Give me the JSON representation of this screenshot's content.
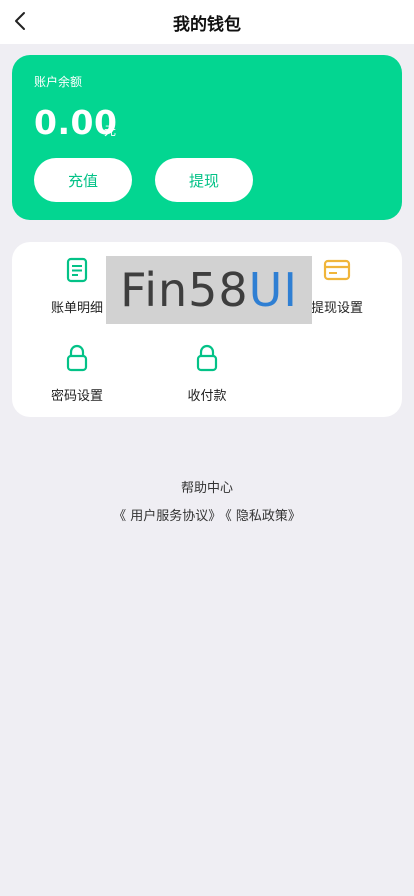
{
  "header": {
    "title": "我的钱包"
  },
  "balance": {
    "label": "账户余额",
    "amount": "0.00",
    "unit": "元",
    "recharge_label": "充值",
    "withdraw_label": "提现"
  },
  "menu": {
    "items": [
      {
        "label": "账单明细",
        "icon": "bill-icon",
        "color": "#03c287"
      },
      {
        "label": "",
        "icon": "obscured-icon",
        "color": "#e24a4a"
      },
      {
        "label": "提现设置",
        "icon": "card-icon",
        "color": "#f0b53a"
      },
      {
        "label": "密码设置",
        "icon": "lock-icon",
        "color": "#03c287"
      },
      {
        "label": "收付款",
        "icon": "lock-icon",
        "color": "#03c287"
      }
    ]
  },
  "watermark": {
    "part1": "Fin58",
    "part2": "UI"
  },
  "footer": {
    "help": "帮助中心",
    "user_agreement": "《 用户服务协议》",
    "privacy_policy": "《 隐私政策》"
  },
  "colors": {
    "brand_green": "#03d691",
    "background": "#efeef3"
  }
}
